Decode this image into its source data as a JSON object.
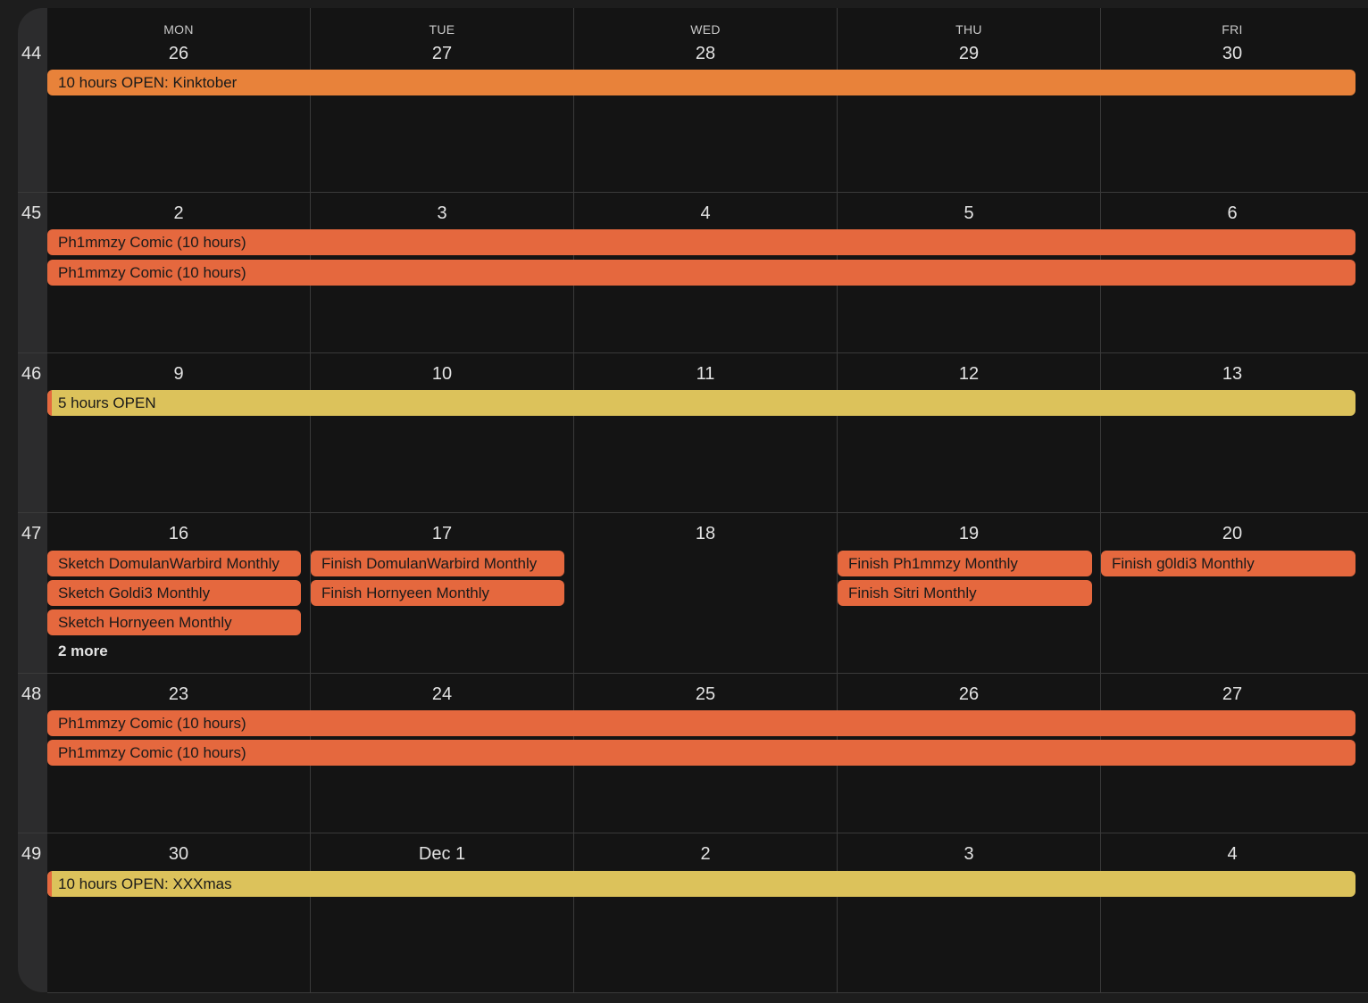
{
  "weekdays": [
    "MON",
    "TUE",
    "WED",
    "THU",
    "FRI"
  ],
  "weeks": [
    {
      "number": "44",
      "days": [
        "26",
        "27",
        "28",
        "29",
        "30"
      ]
    },
    {
      "number": "45",
      "days": [
        "2",
        "3",
        "4",
        "5",
        "6"
      ]
    },
    {
      "number": "46",
      "days": [
        "9",
        "10",
        "11",
        "12",
        "13"
      ]
    },
    {
      "number": "47",
      "days": [
        "16",
        "17",
        "18",
        "19",
        "20"
      ]
    },
    {
      "number": "48",
      "days": [
        "23",
        "24",
        "25",
        "26",
        "27"
      ]
    },
    {
      "number": "49",
      "days": [
        "30",
        "Dec 1",
        "2",
        "3",
        "4"
      ]
    }
  ],
  "events": {
    "w44_kinktober": "10 hours OPEN: Kinktober",
    "w45_comic_1": "Ph1mmzy Comic (10 hours)",
    "w45_comic_2": "Ph1mmzy Comic (10 hours)",
    "w46_open": "5 hours OPEN",
    "w47_mon_1": "Sketch DomulanWarbird Monthly",
    "w47_mon_2": "Sketch Goldi3 Monthly",
    "w47_mon_3": "Sketch Hornyeen Monthly",
    "w47_mon_more": "2 more",
    "w47_tue_1": "Finish DomulanWarbird Monthly",
    "w47_tue_2": "Finish Hornyeen Monthly",
    "w47_thu_1": "Finish Ph1mmzy Monthly",
    "w47_thu_2": "Finish Sitri Monthly",
    "w47_fri_1": "Finish g0ldi3 Monthly",
    "w48_comic_1": "Ph1mmzy Comic (10 hours)",
    "w48_comic_2": "Ph1mmzy Comic (10 hours)",
    "w49_xxxmas": "10 hours OPEN: XXXmas"
  },
  "colors": {
    "kinktober": "#e8823a",
    "task": "#e5683e",
    "open": "#dcc25b",
    "background": "#141414"
  }
}
